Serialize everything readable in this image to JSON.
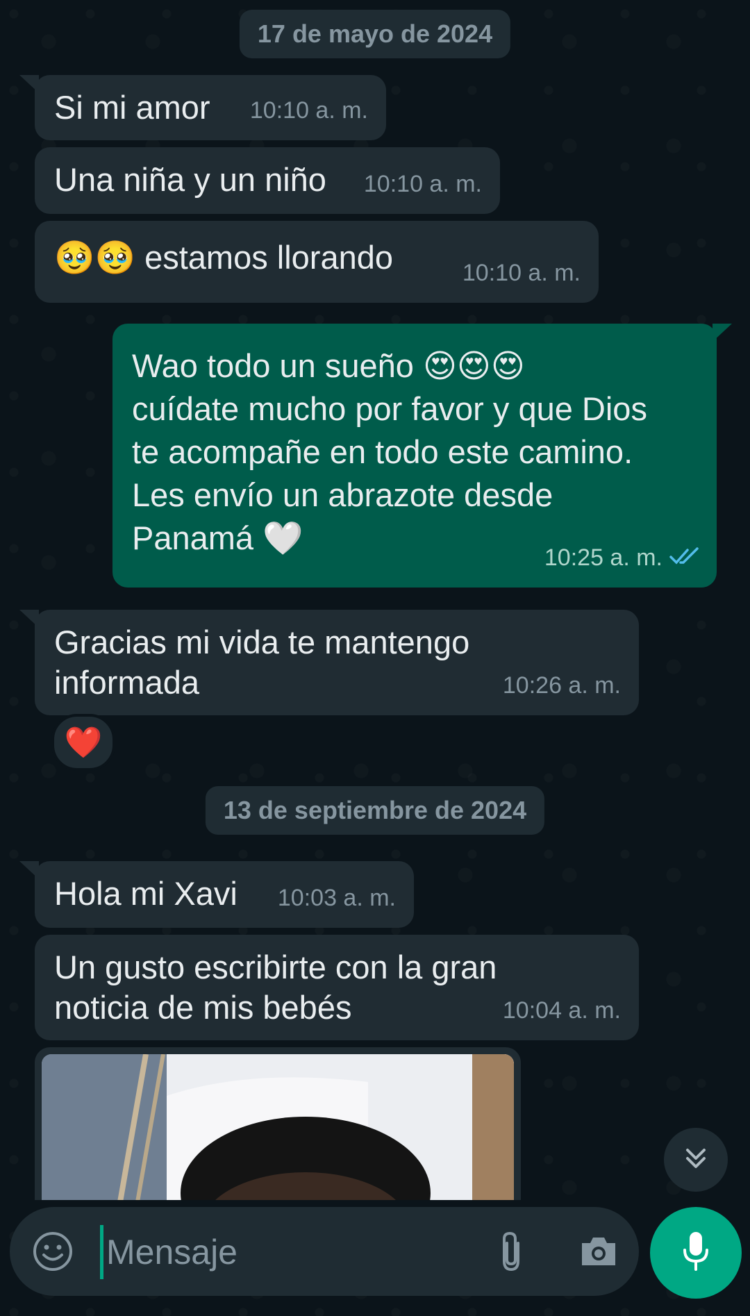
{
  "chat": {
    "dates": [
      "17 de mayo de 2024",
      "13 de septiembre de 2024"
    ],
    "messages": [
      {
        "text": "Si mi amor",
        "time": "10:10 a. m."
      },
      {
        "text": "Una niña y un niño",
        "time": "10:10 a. m."
      },
      {
        "text": "🥹🥹 estamos llorando",
        "time": "10:10 a. m."
      },
      {
        "text": "Wao todo un sueño 😍😍😍\ncuídate mucho por favor y que Dios\nte acompañe en todo este camino.\nLes envío un abrazote desde\nPanamá 🤍",
        "time": "10:25 a. m.",
        "status": "read"
      },
      {
        "text": "Gracias mi vida te mantengo\ninformada",
        "time": "10:26 a. m.",
        "reaction": "❤️"
      },
      {
        "text": "Hola mi Xavi",
        "time": "10:03 a. m."
      },
      {
        "text": "Un gusto escribirte con la gran\nnoticia de mis bebés",
        "time": "10:04 a. m."
      }
    ]
  },
  "composer": {
    "placeholder": "Mensaje"
  },
  "icons": {
    "emoji": "emoji-icon",
    "attach": "paperclip-icon",
    "camera": "camera-icon",
    "mic": "microphone-icon",
    "scroll": "double-chevron-down-icon",
    "ticks": "double-check-icon"
  },
  "colors": {
    "background": "#0b141a",
    "incoming": "#202c33",
    "outgoing": "#005c4b",
    "accent": "#00a884",
    "read_ticks": "#53bdeb"
  }
}
